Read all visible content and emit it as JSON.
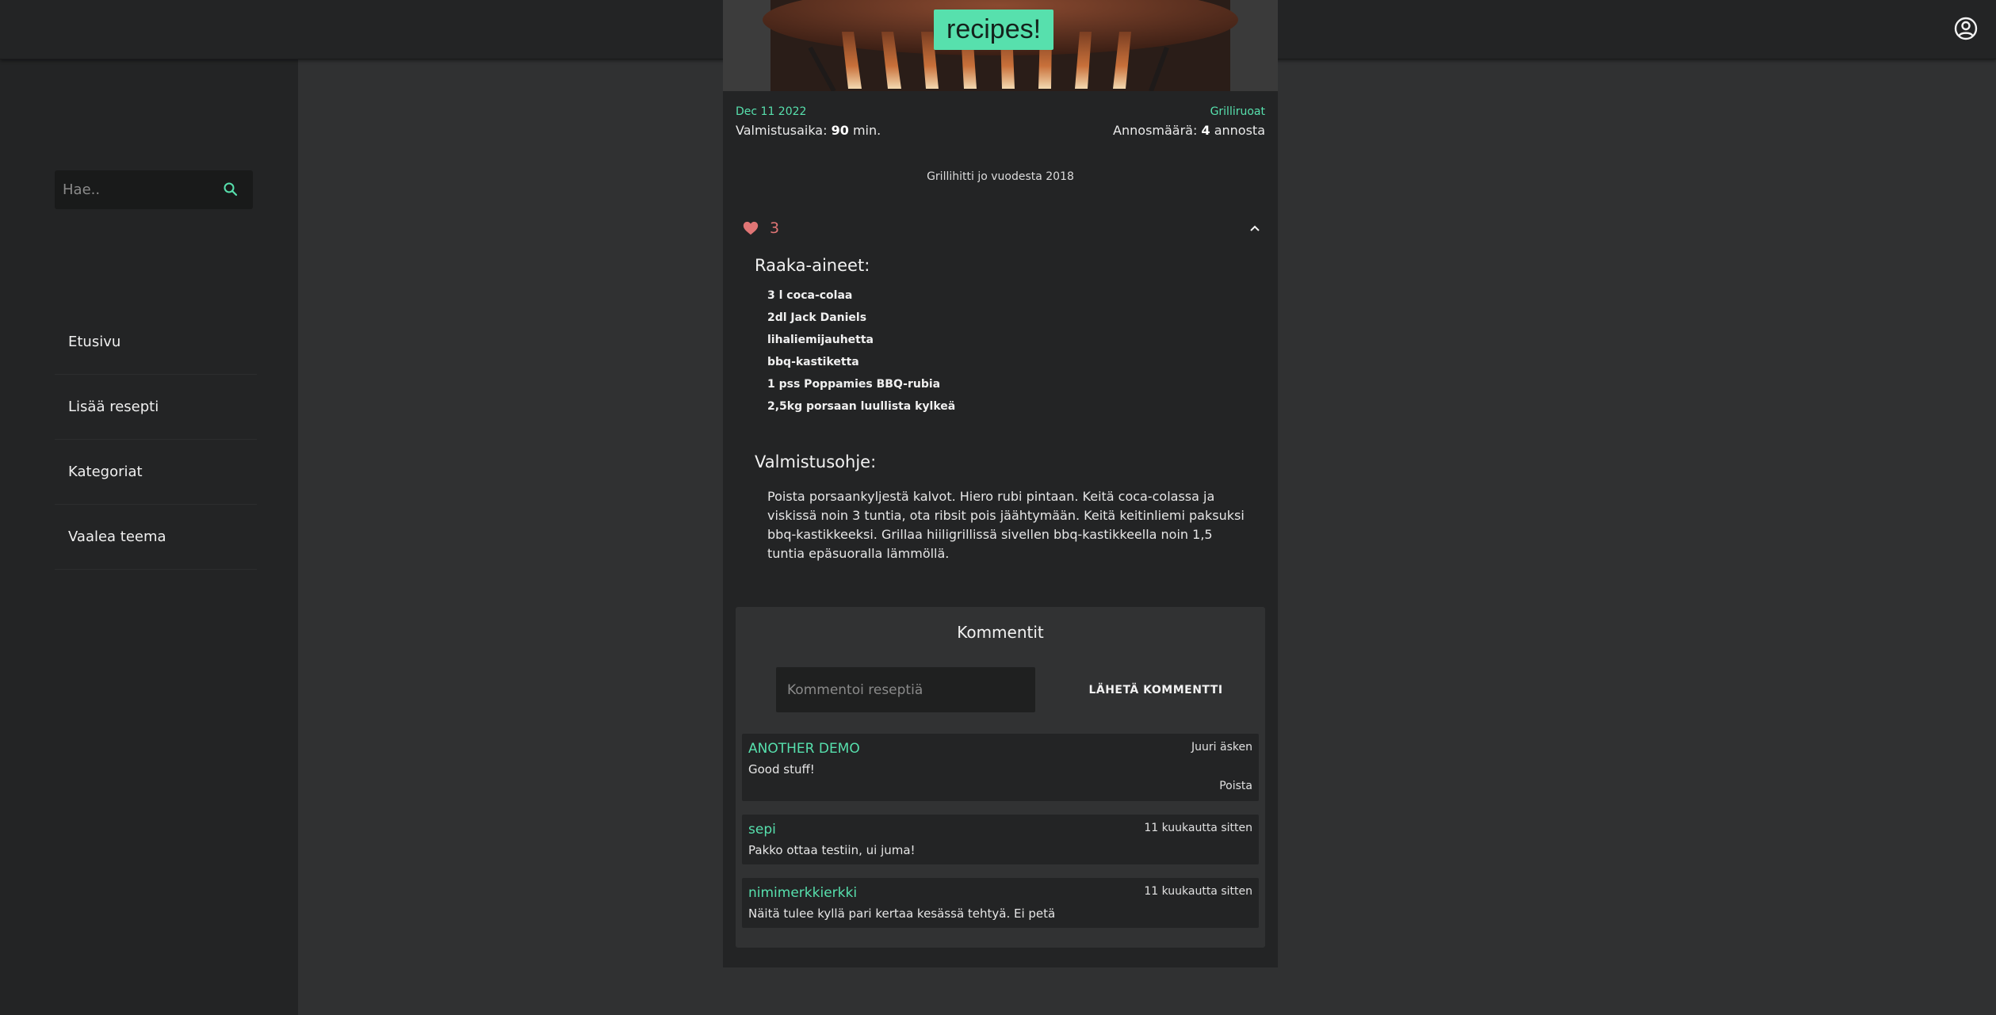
{
  "app": {
    "logo": "recipes!"
  },
  "search": {
    "placeholder": "Hae.."
  },
  "nav": {
    "items": [
      "Etusivu",
      "Lisää resepti",
      "Kategoriat",
      "Vaalea teema"
    ]
  },
  "recipe": {
    "date": "Dec 11 2022",
    "category": "Grilliruoat",
    "prep_label": "Valmistusaika:",
    "prep_value": "90",
    "prep_unit": "min.",
    "servings_label": "Annosmäärä:",
    "servings_value": "4",
    "servings_unit": "annosta",
    "description": "Grillihitti jo vuodesta 2018",
    "likes": "3",
    "ingredients_title": "Raaka-aineet:",
    "ingredients": [
      "3 l coca-colaa",
      "2dl Jack Daniels",
      "lihaliemijauhetta",
      "bbq-kastiketta",
      "1 pss Poppamies BBQ-rubia",
      "2,5kg porsaan luullista kylkeä"
    ],
    "instructions_title": "Valmistusohje:",
    "instructions": "Poista porsaankyljestä kalvot. Hiero rubi pintaan. Keitä coca-colassa ja viskissä noin 3 tuntia, ota ribsit pois jäähtymään. Keitä keitinliemi paksuksi bbq-kastikkeeksi. Grillaa hiiligrillissä sivellen bbq-kastikkeella noin 1,5 tuntia epäsuoralla lämmöllä."
  },
  "comments": {
    "title": "Kommentit",
    "input_placeholder": "Kommentoi reseptiä",
    "send_label": "LÄHETÄ KOMMENTTI",
    "delete_label": "Poista",
    "items": [
      {
        "author": "ANOTHER DEMO",
        "time": "Juuri äsken",
        "text": "Good stuff!"
      },
      {
        "author": "sepi",
        "time": "11 kuukautta sitten",
        "text": "Pakko ottaa testiin, ui juma!"
      },
      {
        "author": "nimimerkkierkki",
        "time": "11 kuukautta sitten",
        "text": "Näitä tulee kyllä pari kertaa kesässä tehtyä. Ei petä"
      }
    ]
  },
  "colors": {
    "accent": "#57e0ad",
    "like": "#e07575",
    "background": "#303132",
    "surface": "#232425"
  },
  "icons": {
    "account": "account-circle-icon",
    "search": "search-icon",
    "like": "heart-icon",
    "collapse": "chevron-up-icon"
  }
}
